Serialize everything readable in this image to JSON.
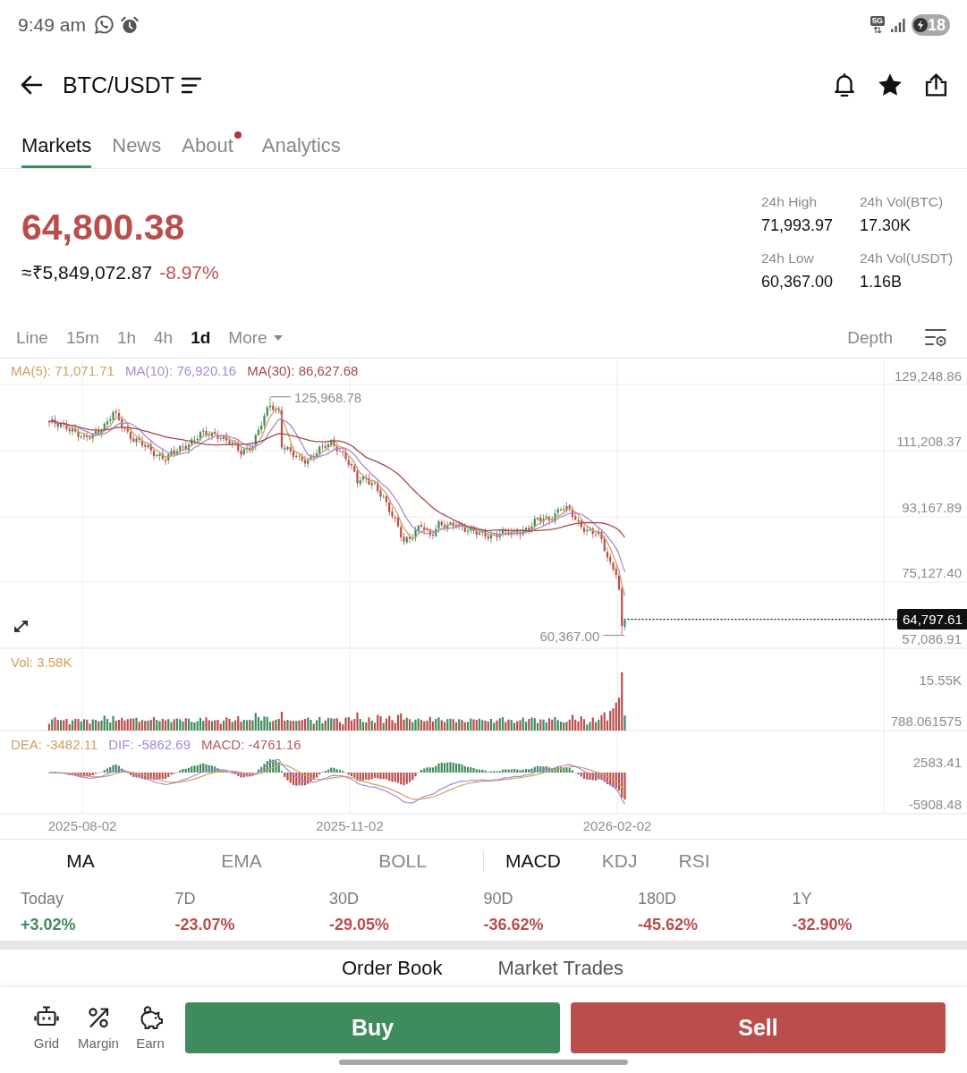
{
  "status_bar": {
    "time": "9:49 am",
    "network": "5G",
    "battery": "18"
  },
  "header": {
    "title": "BTC/USDT"
  },
  "tabs": [
    {
      "label": "Markets",
      "selected": true,
      "badge": false
    },
    {
      "label": "News",
      "selected": false,
      "badge": false
    },
    {
      "label": "About",
      "selected": false,
      "badge": true
    },
    {
      "label": "Analytics",
      "selected": false,
      "badge": false
    }
  ],
  "ticker": {
    "price": "64,800.38",
    "fiat_price": "≈₹5,849,072.87",
    "change": "-8.97%",
    "negative": true,
    "stats": [
      {
        "label": "24h High",
        "value": "71,993.97"
      },
      {
        "label": "24h Vol(BTC)",
        "value": "17.30K"
      },
      {
        "label": "24h Low",
        "value": "60,367.00"
      },
      {
        "label": "24h Vol(USDT)",
        "value": "1.16B"
      }
    ]
  },
  "intervals": [
    {
      "label": "Line",
      "kind": "interval",
      "selected": false
    },
    {
      "label": "15m",
      "kind": "interval",
      "selected": false
    },
    {
      "label": "1h",
      "kind": "interval",
      "selected": false
    },
    {
      "label": "4h",
      "kind": "interval",
      "selected": false
    },
    {
      "label": "1d",
      "kind": "interval",
      "selected": true
    },
    {
      "label": "More",
      "kind": "dropdown",
      "selected": false
    }
  ],
  "depth": {
    "label": "Depth"
  },
  "chart": {
    "legend": [
      {
        "label": "MA(5): 71,071.71",
        "color": "#d0a15c"
      },
      {
        "label": "MA(10): 76,920.16",
        "color": "#a689d6"
      },
      {
        "label": "MA(30): 86,627.68",
        "color": "#a64848"
      }
    ],
    "y_labels": [
      "129,248.86",
      "111,208.37",
      "93,167.89",
      "75,127.40",
      "57,086.91"
    ],
    "high_label": "125,968.78",
    "low_label": "60,367.00",
    "last_price": "64,797.61",
    "volume": {
      "legend": "Vol: 3.58K",
      "y_labels": [
        "15.55K",
        "788.061575"
      ]
    },
    "macd": {
      "legend": [
        {
          "label": "DEA: -3482.11",
          "color": "#d0a15c"
        },
        {
          "label": "DIF: -5862.69",
          "color": "#a689d6"
        },
        {
          "label": "MACD: -4761.16",
          "color": "#b35c5c"
        }
      ],
      "y_labels": [
        "2583.41",
        "-5908.48"
      ]
    },
    "x_labels": [
      "2025-08-02",
      "2025-11-02",
      "2026-02-02"
    ]
  },
  "indicators": {
    "main": [
      {
        "label": "MA",
        "selected": true
      },
      {
        "label": "EMA",
        "selected": false
      },
      {
        "label": "BOLL",
        "selected": false
      }
    ],
    "sub": [
      {
        "label": "MACD",
        "selected": true
      },
      {
        "label": "KDJ",
        "selected": false
      },
      {
        "label": "RSI",
        "selected": false
      }
    ]
  },
  "performance": [
    {
      "period": "Today",
      "change": "+3.02%",
      "negative": false
    },
    {
      "period": "7D",
      "change": "-23.07%",
      "negative": true
    },
    {
      "period": "30D",
      "change": "-29.05%",
      "negative": true
    },
    {
      "period": "90D",
      "change": "-36.62%",
      "negative": true
    },
    {
      "period": "180D",
      "change": "-45.62%",
      "negative": true
    },
    {
      "period": "1Y",
      "change": "-32.90%",
      "negative": true
    }
  ],
  "trade_tabs": [
    {
      "label": "Order Book",
      "selected": true
    },
    {
      "label": "Market Trades",
      "selected": false
    }
  ],
  "bottom_nav": [
    {
      "label": "Grid",
      "kind": "robot"
    },
    {
      "label": "Margin",
      "kind": "percent"
    },
    {
      "label": "Earn",
      "kind": "piggybank"
    }
  ],
  "actions": [
    {
      "label": "Buy",
      "kind": "buy"
    },
    {
      "label": "Sell",
      "kind": "sell"
    }
  ]
}
